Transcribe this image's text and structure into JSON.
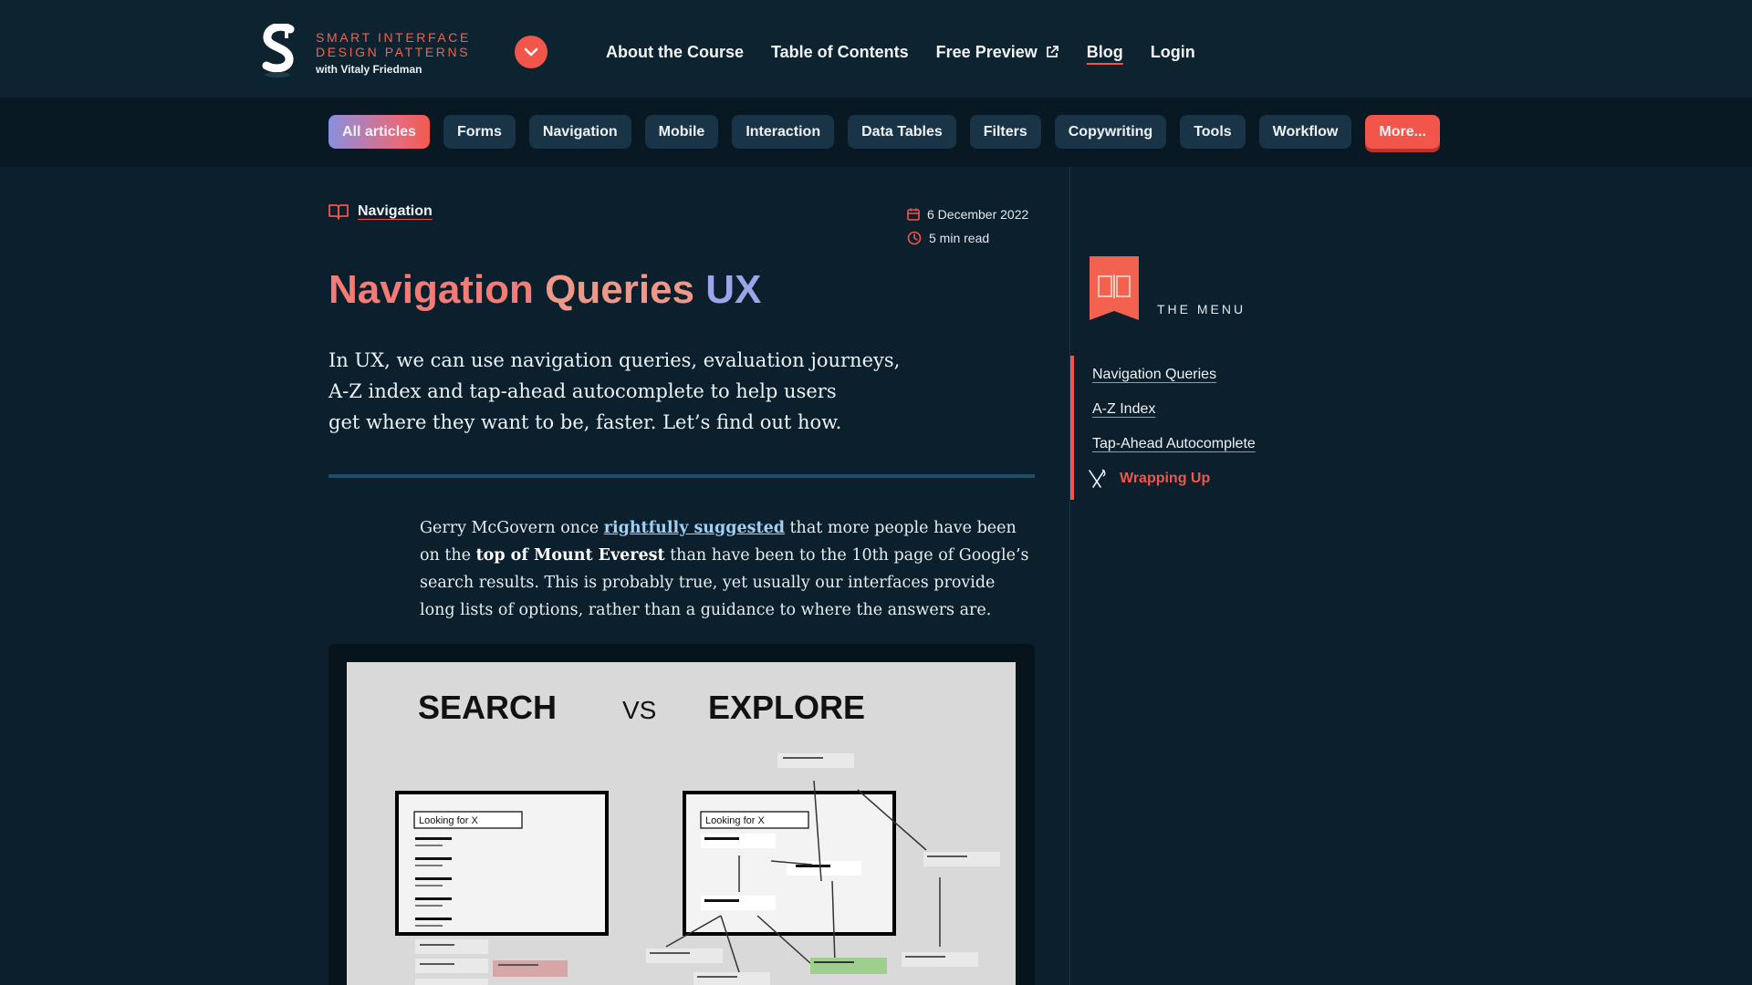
{
  "header": {
    "logo": {
      "line1": "SMART INTERFACE",
      "line2": "DESIGN PATTERNS",
      "line3": "with Vitaly Friedman"
    },
    "nav": [
      {
        "label": "About the Course"
      },
      {
        "label": "Table of Contents"
      },
      {
        "label": "Free Preview",
        "icon": "external-link-icon"
      },
      {
        "label": "Blog",
        "active": true
      },
      {
        "label": "Login"
      }
    ]
  },
  "categories": [
    "All articles",
    "Forms",
    "Navigation",
    "Mobile",
    "Interaction",
    "Data Tables",
    "Filters",
    "Copywriting",
    "Tools",
    "Workflow",
    "More..."
  ],
  "article": {
    "category": "Navigation",
    "date": "6 December 2022",
    "read_time": "5 min read",
    "title": {
      "part1": "Navigation",
      "part2": "Queries",
      "part3": "UX"
    },
    "lead_lines": [
      "In UX, we can use navigation queries, evaluation journeys,",
      "A-Z index and tap-ahead autocomplete to help users",
      "get where they want to be, faster. Let’s find out how."
    ],
    "body": {
      "l1_pre": "Gerry McGovern once ",
      "l1_link": "rightfully suggested",
      "l1_post": " that more people have been",
      "l2_pre": "on the ",
      "l2_bold": "top of Mount Everest",
      "l2_post": " than have been to the 10th page of Google’s",
      "l3": "search results. This is probably true, yet usually our interfaces provide",
      "l4": "long lists of options, rather than a guidance to where the answers are."
    },
    "figure": {
      "search": "SEARCH",
      "vs": "VS",
      "explore": "EXPLORE",
      "field1": "Looking for X",
      "field2": "Looking for X"
    }
  },
  "sidebar": {
    "menu_title": "THE MENU",
    "toc": [
      {
        "label": "Navigation Queries"
      },
      {
        "label": "A-Z Index"
      },
      {
        "label": "Tap-Ahead Autocomplete"
      },
      {
        "label": "Wrapping Up",
        "current": true
      }
    ]
  },
  "colors": {
    "background": "#0b1f2c",
    "accent": "#f2554a",
    "pill": "#193446"
  }
}
